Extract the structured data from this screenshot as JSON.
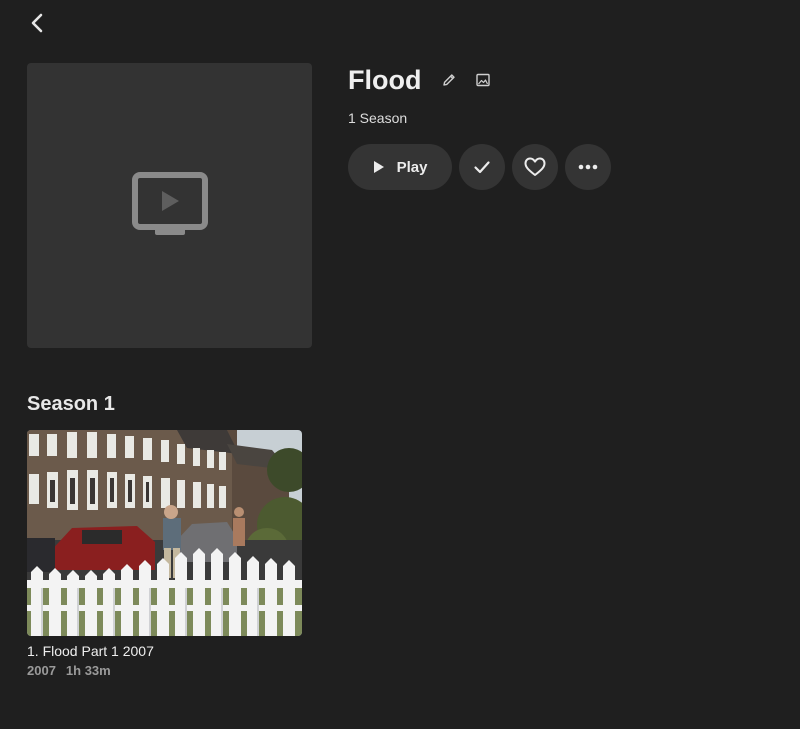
{
  "show": {
    "title": "Flood",
    "seasons_count": "1 Season"
  },
  "actions": {
    "play_label": "Play"
  },
  "icons": {
    "back": "chevron-left-icon",
    "edit": "pencil-icon",
    "image": "image-icon",
    "placeholder": "tv-icon",
    "play": "play-icon",
    "watched": "check-icon",
    "favorite": "heart-icon",
    "more": "more-horizontal-icon"
  },
  "season": {
    "title": "Season 1",
    "episodes": [
      {
        "title": "1. Flood Part 1 2007",
        "year": "2007",
        "runtime": "1h 33m"
      }
    ]
  },
  "colors": {
    "background": "#1f1f1f",
    "surface": "#343434",
    "poster_placeholder": "#333333",
    "text_primary": "#ececec",
    "text_secondary": "#9a9a9a"
  }
}
